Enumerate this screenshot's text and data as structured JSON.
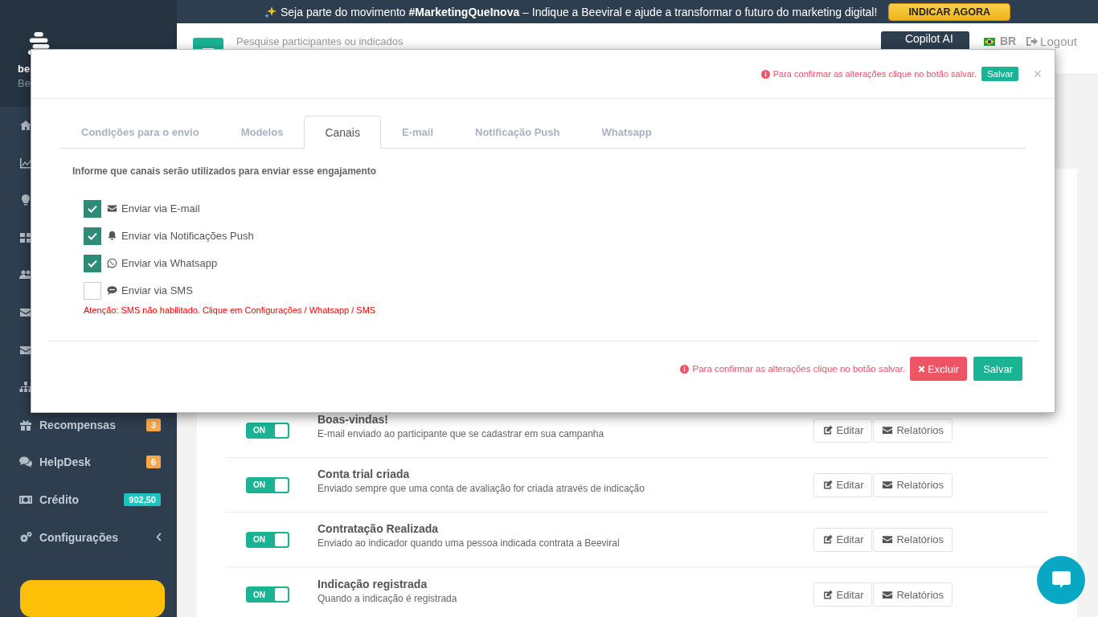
{
  "banner": {
    "text": "Seja parte do movimento **#MarketingQueInova** – Indique a Beeviral e ajude a transformar o futuro do marketing digital!",
    "button": "INDICAR AGORA"
  },
  "sidebar": {
    "user_name": "be",
    "user_subtitle": "Be",
    "items": [
      {
        "kind": "home"
      },
      {
        "kind": "chart"
      },
      {
        "kind": "bulb"
      },
      {
        "kind": "grid"
      },
      {
        "kind": "users"
      },
      {
        "kind": "envelope"
      },
      {
        "kind": "envelope"
      },
      {
        "kind": "sitemap"
      },
      {
        "kind": "gift",
        "label": "Recompensas",
        "badge": "3",
        "color": "#f6a84f"
      },
      {
        "kind": "comments",
        "label": "HelpDesk",
        "badge": "6",
        "color": "#f6a84f"
      },
      {
        "kind": "money",
        "label": "Crédito",
        "badge": "902,50",
        "color": "#1fc2c2"
      },
      {
        "kind": "cogs",
        "label": "Configurações",
        "expanded": false
      }
    ]
  },
  "header": {
    "search": {
      "placeholder": "Pesquise participantes ou indicados"
    },
    "copilot": "Copilot AI",
    "language": "BR",
    "logout": "Logout"
  },
  "engagements": [
    {
      "on": true,
      "toggle_label": "ON",
      "title": "Boas-vindas!",
      "description": "E-mail enviado ao participante que se cadastrar em sua campanha",
      "edit": "Editar",
      "reports": "Relatórios"
    },
    {
      "on": true,
      "toggle_label": "ON",
      "title": "Conta trial criada",
      "description": "Enviado sempre que uma conta de avaliação for criada através de indicação",
      "edit": "Editar",
      "reports": "Relatórios"
    },
    {
      "on": true,
      "toggle_label": "ON",
      "title": "Contratação Realizada",
      "description": "Enviado ao indicador quando uma pessoa indicada contrata a Beeviral",
      "edit": "Editar",
      "reports": "Relatórios"
    },
    {
      "on": true,
      "toggle_label": "ON",
      "title": "Indicação registrada",
      "description": "Quando a indicação é registrada",
      "edit": "Editar",
      "reports": "Relatórios"
    }
  ],
  "modal": {
    "header_notice": "Para confirmar as alterações clique no botão salvar.",
    "header_save": "Salvar",
    "close": "×",
    "tabs": [
      {
        "label": "Condições para o envio",
        "selected": false
      },
      {
        "label": "Modelos",
        "selected": false
      },
      {
        "label": "Canais",
        "selected": true
      },
      {
        "label": "E-mail",
        "selected": false
      },
      {
        "label": "Notificação Push",
        "selected": false
      },
      {
        "label": "Whatsapp",
        "selected": false
      }
    ],
    "intro": "Informe que canais serão utilizados para enviar esse engajamento",
    "channels": [
      {
        "kind": "email",
        "label": "Enviar via E-mail",
        "checked": true
      },
      {
        "kind": "push",
        "label": "Enviar via Notificações Push",
        "checked": true
      },
      {
        "kind": "whatsapp",
        "label": "Enviar via Whatsapp",
        "checked": true
      },
      {
        "kind": "sms",
        "label": "Enviar via SMS",
        "checked": false
      }
    ],
    "warning": "Atenção: SMS não habilitado. Clique em Configurações / Whatsapp / SMS",
    "footer_notice": "Para confirmar as alterações clique no botão salvar.",
    "delete": "Excluir",
    "save": "Salvar"
  }
}
